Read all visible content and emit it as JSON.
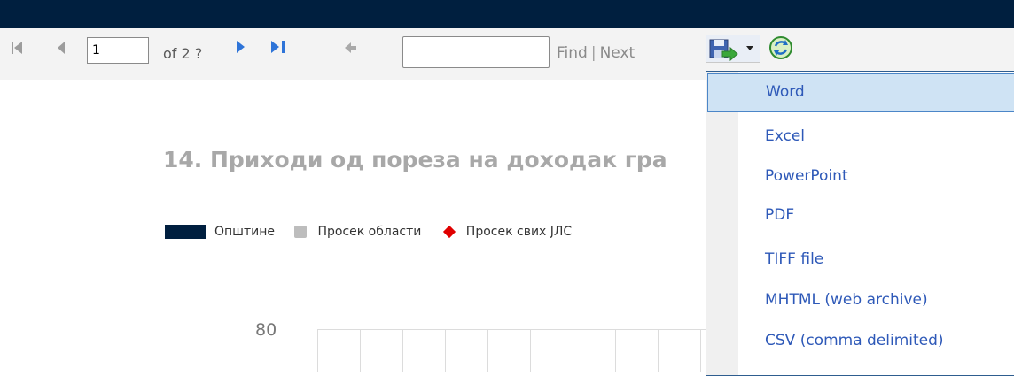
{
  "toolbar": {
    "page_value": "1",
    "page_of": "of 2 ?",
    "search_value": "",
    "find_label": "Find",
    "separator": "|",
    "next_label": "Next"
  },
  "report": {
    "title": "14. Приходи од пореза на доходак гра",
    "legend": [
      {
        "label": "Општине",
        "color": "#001f3f"
      },
      {
        "label": "Просек области",
        "color": "#bdbdbd"
      },
      {
        "label": "Просек свих ЈЛС",
        "color": "#e00000"
      }
    ],
    "y_tick": "80"
  },
  "export_menu": {
    "items": [
      {
        "label": "Word",
        "selected": true
      },
      {
        "label": "Excel"
      },
      {
        "label": "PowerPoint"
      },
      {
        "label": "PDF"
      },
      {
        "label": "TIFF file"
      },
      {
        "label": "MHTML (web archive)"
      },
      {
        "label": "CSV (comma delimited)"
      }
    ]
  },
  "icons": {
    "first_page": "first-page-icon",
    "prev_page": "previous-page-icon",
    "next_page": "next-page-icon",
    "last_page": "last-page-icon",
    "back": "back-to-parent-icon",
    "export": "export-save-icon",
    "refresh": "refresh-icon"
  },
  "colors": {
    "header": "#001f3f",
    "accent": "#2e74d8",
    "menu_text": "#2e59b8"
  }
}
